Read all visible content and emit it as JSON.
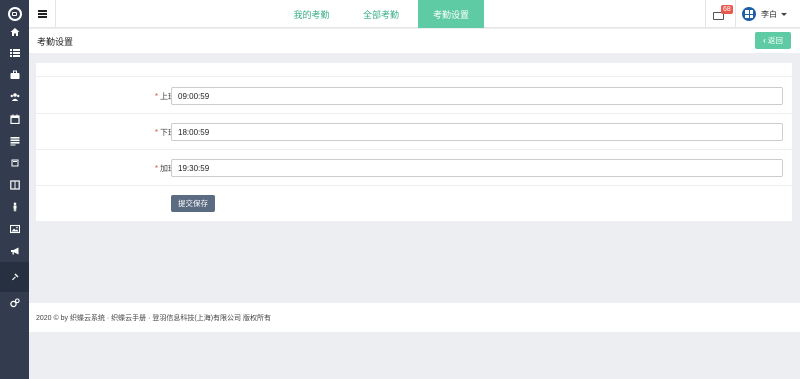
{
  "sidebar": {
    "icons": [
      "logo-icon",
      "home-icon",
      "list-icon",
      "briefcase-icon",
      "users-icon",
      "calendar-icon",
      "table-icon",
      "book-icon",
      "columns-icon",
      "person-icon",
      "image-icon",
      "bullhorn-icon",
      "gavel-icon",
      "settings-icon"
    ]
  },
  "topbar": {
    "tabs": [
      {
        "label": "我的考勤"
      },
      {
        "label": "全部考勤"
      },
      {
        "label": "考勤设置"
      }
    ],
    "mail_badge": "68",
    "user_name": "李白"
  },
  "page": {
    "title": "考勤设置",
    "back_label": "返回"
  },
  "form": {
    "fields": [
      {
        "label": "上班时间",
        "value": "09:00:59"
      },
      {
        "label": "下班时间",
        "value": "18:00:59"
      },
      {
        "label": "加班时间",
        "value": "19:30:59"
      }
    ],
    "submit_label": "提交保存",
    "required_mark": "*"
  },
  "footer": {
    "text": "2020 © by 织蝶云系统 · 织蝶云手册 · 登羽信息科技(上海)有限公司 版权所有"
  },
  "colors": {
    "accent": "#5fcba4",
    "sidebar": "#323c4e",
    "submit": "#5b6b82",
    "required": "#e74c3c"
  }
}
